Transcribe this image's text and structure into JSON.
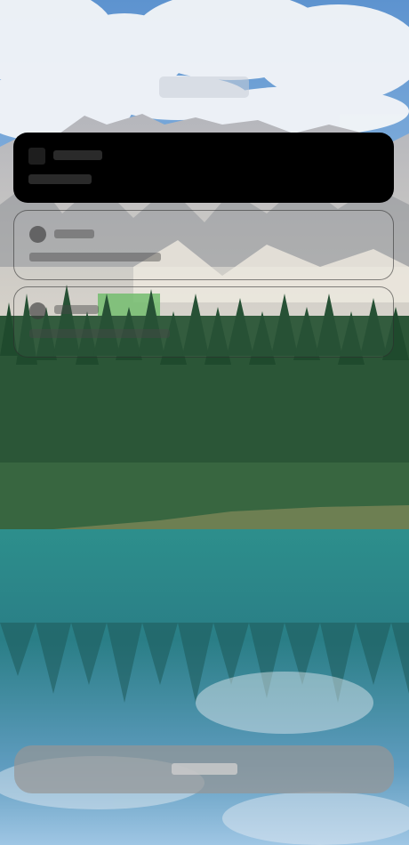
{
  "app": {
    "name": "",
    "screen": "lock-screen"
  },
  "wallpaper": {
    "description_icon": "landscape-wallpaper",
    "colors": {
      "sky": "#7fb1dc",
      "clouds": "#f2f4f7",
      "mountains": "#b9b9bd",
      "forest": "#2e5a3a",
      "lake": "#2f8c8d"
    }
  },
  "header": {
    "time_text": ""
  },
  "notifications": [
    {
      "app_label": "",
      "body": "",
      "style": "dark"
    },
    {
      "app_label": "",
      "body": "",
      "style": "outline"
    },
    {
      "app_label": "",
      "body": "",
      "style": "outline"
    }
  ],
  "bottom_action": {
    "label": ""
  }
}
